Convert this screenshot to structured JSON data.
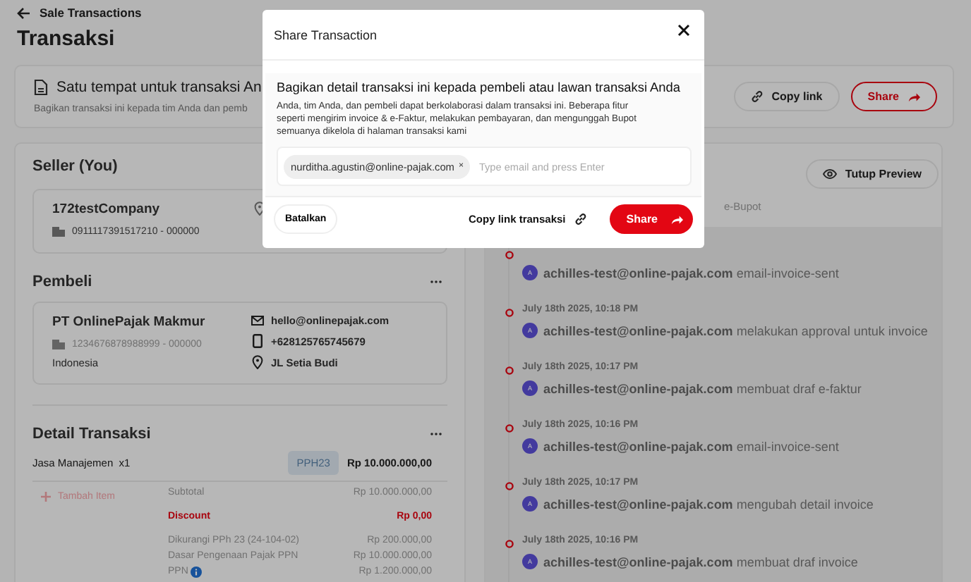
{
  "header": {
    "back_label": "Sale Transactions",
    "title": "Transaksi"
  },
  "banner": {
    "title": "Satu tempat untuk transaksi An",
    "subtitle": "Bagikan transaksi ini kepada tim Anda dan pemb",
    "buttons": [
      {
        "label": "Copy link",
        "kind": "link"
      },
      {
        "label": "Share",
        "kind": "share"
      }
    ]
  },
  "seller": {
    "heading": "Seller (You)",
    "name": "172testCompany",
    "tax_id": "0911117391517210 - 000000"
  },
  "buyer": {
    "heading": "Pembeli",
    "name": "PT OnlinePajak Makmur",
    "tax_id": "1234676878988999 - 000000",
    "country": "Indonesia",
    "contacts": [
      {
        "kind": "email",
        "text": "hello@onlinepajak.com"
      },
      {
        "kind": "phone",
        "text": "+628125765745679"
      },
      {
        "kind": "address",
        "text": "JL Setia Budi"
      }
    ]
  },
  "detail": {
    "heading": "Detail Transaksi",
    "items": [
      {
        "name": "Jasa Manajemen",
        "qty": "x1",
        "tag": "PPH23",
        "amount": "Rp 10.000.000,00"
      }
    ],
    "add_item": {
      "label": "Tambah Item",
      "disabled": true
    },
    "summary": [
      {
        "label": "Subtotal",
        "value": "Rp 10.000.000,00",
        "kind": "normal",
        "info": false
      },
      {
        "label": "Discount",
        "value": "Rp 0,00",
        "kind": "discount",
        "info": false
      },
      {
        "label": "Dikurangi PPh 23 (24-104-02)",
        "value": "Rp 200.000,00",
        "kind": "normal",
        "info": false
      },
      {
        "label": "Dasar Pengenaan Pajak PPN",
        "value": "Rp 10.000.000,00",
        "kind": "normal",
        "info": false
      },
      {
        "label": "PPN",
        "value": "Rp 1.200.000,00",
        "kind": "normal",
        "info": true
      }
    ]
  },
  "preview": {
    "button": "Tutup Preview",
    "tabs": [
      {
        "label": "e-Bupot",
        "selected": false
      }
    ],
    "timeline": [
      {
        "avatar": "A",
        "user": "achilles-test@online-pajak.com",
        "action": "email-invoice-sent"
      },
      {
        "date": "July 18th 2025, 10:18 PM",
        "avatar": "A",
        "user": "achilles-test@online-pajak.com",
        "action": "melakukan approval untuk invoice"
      },
      {
        "date": "July 18th 2025, 10:17 PM",
        "avatar": "A",
        "user": "achilles-test@online-pajak.com",
        "action": "membuat draf e-faktur"
      },
      {
        "date": "July 18th 2025, 10:16 PM",
        "avatar": "A",
        "user": "achilles-test@online-pajak.com",
        "action": "email-invoice-sent"
      },
      {
        "date": "July 18th 2025, 10:17 PM",
        "avatar": "A",
        "user": "achilles-test@online-pajak.com",
        "action": "mengubah detail invoice"
      },
      {
        "date": "July 18th 2025, 10:16 PM",
        "avatar": "A",
        "user": "achilles-test@online-pajak.com",
        "action": "membuat draf invoice"
      }
    ]
  },
  "modal": {
    "title": "Share Transaction",
    "heading": "Bagikan detail transaksi ini kepada pembeli atau lawan transaksi Anda",
    "description": "Anda, tim Anda, dan pembeli dapat berkolaborasi dalam transaksi ini. Beberapa fitur seperti mengirim invoice & e-Faktur, melakukan pembayaran, dan mengunggah Bupot semuanya dikelola di halaman transaksi kami",
    "emails": [
      "nurditha.agustin@online-pajak.com"
    ],
    "chip_remove": "×",
    "placeholder": "Type email and press Enter",
    "cancel": "Batalkan",
    "copy_link": "Copy link transaksi",
    "share": "Share"
  }
}
